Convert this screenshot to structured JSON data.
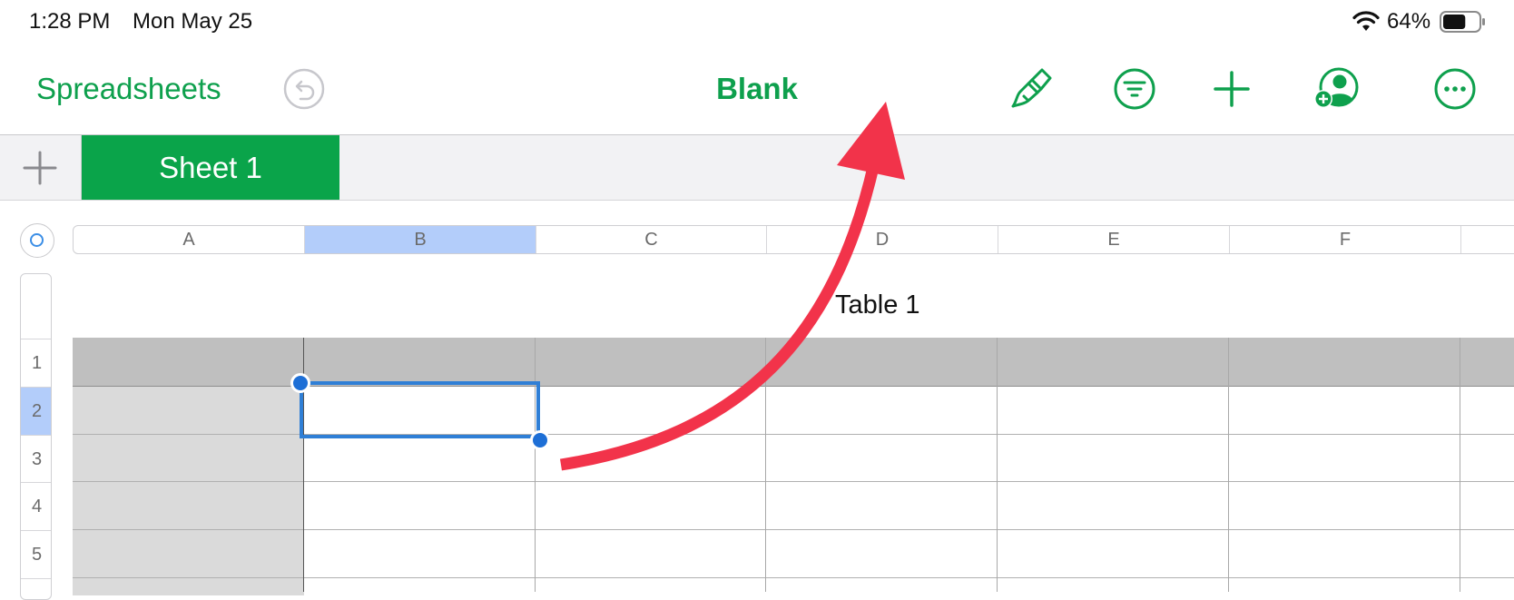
{
  "status_bar": {
    "time": "1:28 PM",
    "date": "Mon May 25",
    "battery_percent": "64%",
    "battery_level": 0.64,
    "icons": [
      "wifi-icon",
      "battery-icon"
    ]
  },
  "toolbar": {
    "back_label": "Spreadsheets",
    "title": "Blank",
    "buttons": [
      "undo-icon",
      "format-brush-icon",
      "organize-filter-icon",
      "add-icon",
      "collaborate-icon",
      "more-icon"
    ]
  },
  "sheet_tabs": {
    "add_icon": "plus-icon",
    "tabs": [
      {
        "label": "Sheet 1",
        "active": true
      }
    ]
  },
  "columns": [
    "A",
    "B",
    "C",
    "D",
    "E",
    "F"
  ],
  "selected_column": "B",
  "rows": [
    "1",
    "2",
    "3",
    "4",
    "5"
  ],
  "selected_row": "2",
  "table": {
    "title": "Table 1"
  },
  "colors": {
    "accent": "#0ea04d",
    "tab_active": "#0aa44a",
    "selection": "#2f7fd6",
    "annotation_arrow": "#f2334a"
  },
  "annotation": {
    "type": "arrow",
    "color": "#f2334a",
    "points_to": "format-brush-icon"
  }
}
